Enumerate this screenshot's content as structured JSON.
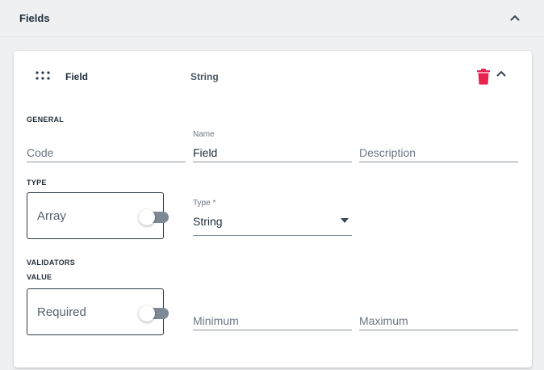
{
  "section": {
    "title": "Fields",
    "chevron_icon": "chevron-up-icon"
  },
  "card": {
    "field_name": "Field",
    "field_type": "String",
    "drag_icon": "drag-handle-icon",
    "delete_icon": "trash-icon",
    "collapse_icon": "chevron-up-icon",
    "delete_color": "#e8234f"
  },
  "general": {
    "label": "GENERAL",
    "code": {
      "placeholder": "Code",
      "value": ""
    },
    "name": {
      "label": "Name",
      "value": "Field"
    },
    "description": {
      "placeholder": "Description",
      "value": ""
    }
  },
  "type_group": {
    "label": "TYPE",
    "array_toggle": {
      "label": "Array",
      "checked": false
    },
    "type_select": {
      "label": "Type *",
      "value": "String"
    }
  },
  "validators": {
    "label": "VALIDATORS",
    "value_label": "VALUE",
    "required_toggle": {
      "label": "Required",
      "checked": false
    },
    "minimum": {
      "placeholder": "Minimum",
      "value": ""
    },
    "maximum": {
      "placeholder": "Maximum",
      "value": ""
    }
  }
}
